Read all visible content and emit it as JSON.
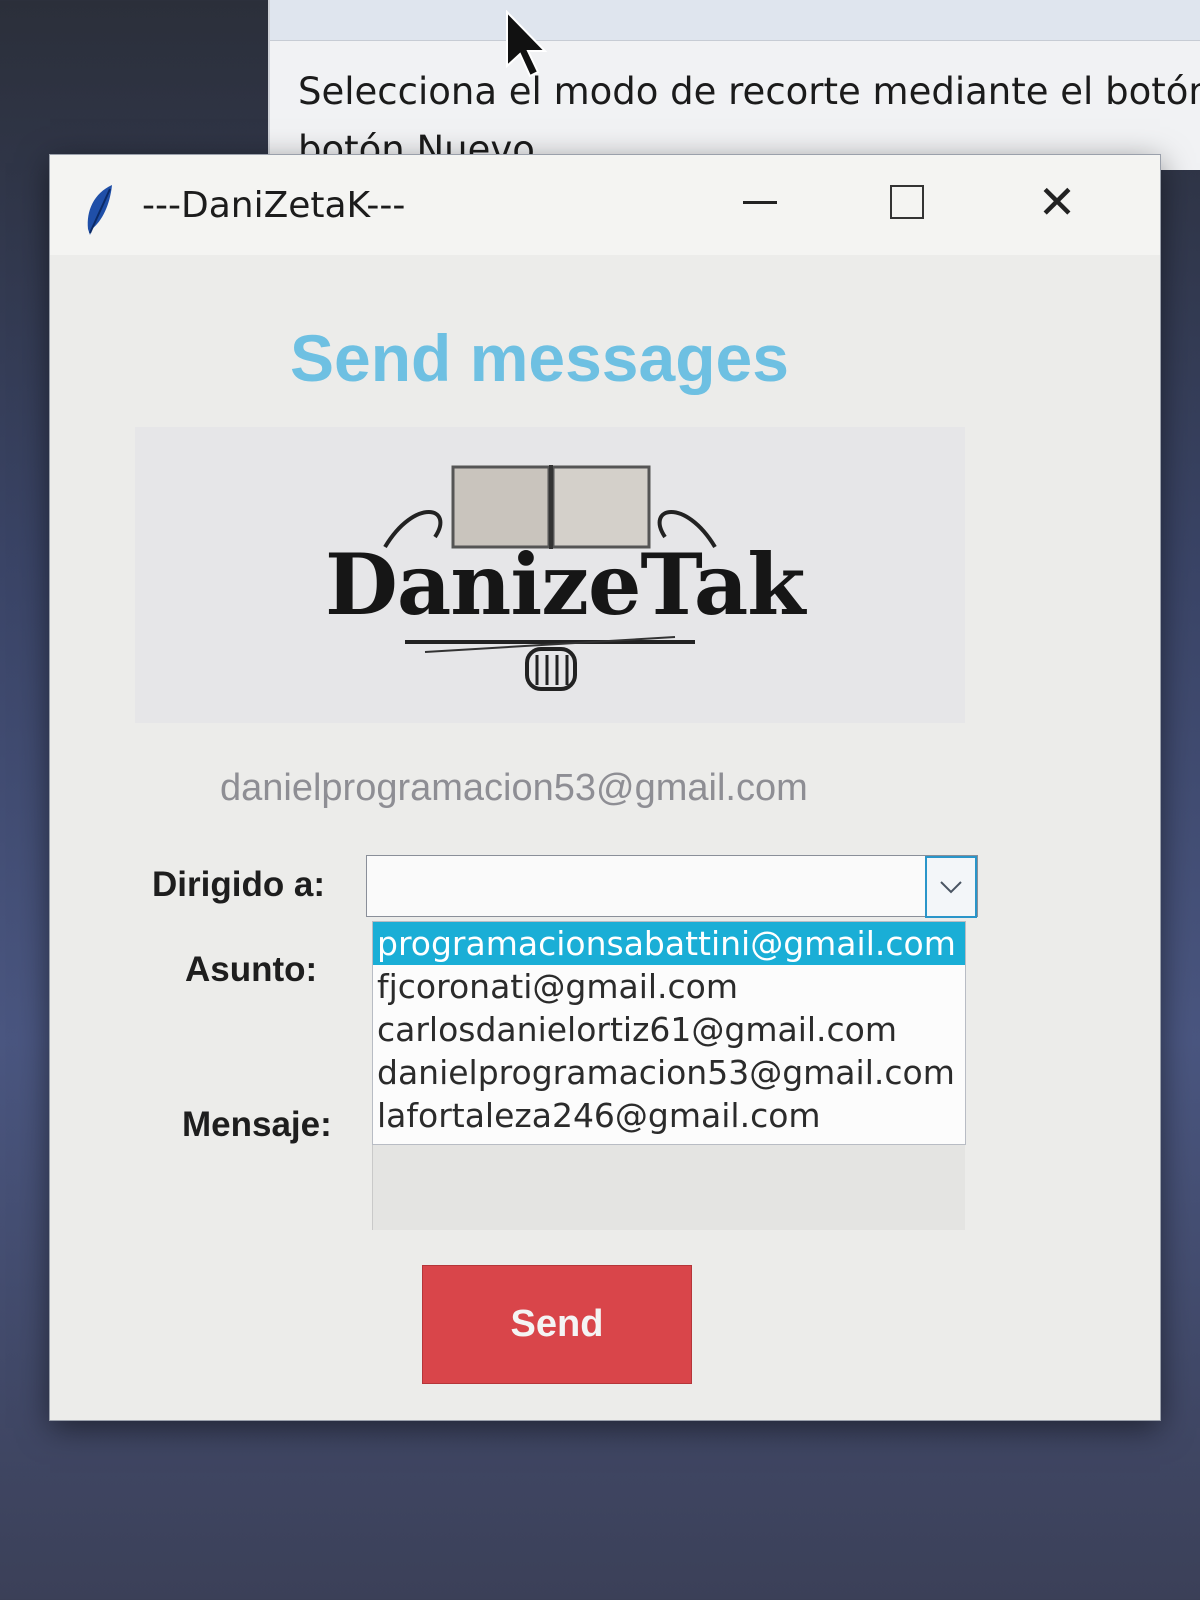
{
  "background_window": {
    "line1": "Selecciona el modo de recorte mediante el botón M",
    "line2": "botón Nuevo"
  },
  "window": {
    "title": "---DaniZetaK---",
    "icon": "feather-icon",
    "controls": {
      "minimize": "minimize-icon",
      "maximize": "maximize-icon",
      "close": "close-icon"
    }
  },
  "header": {
    "title": "Send messages",
    "color": "#6ec0e2"
  },
  "logo": {
    "text": "DanizeTak"
  },
  "sender_email": "danielprogramacion53@gmail.com",
  "form": {
    "to_label": "Dirigido a:",
    "to_value": "",
    "subject_label": "Asunto:",
    "message_label": "Mensaje:",
    "dropdown_options": [
      {
        "label": "programacionsabattini@gmail.com",
        "selected": true
      },
      {
        "label": "fjcoronati@gmail.com",
        "selected": false
      },
      {
        "label": "carlosdanielortiz61@gmail.com",
        "selected": false
      },
      {
        "label": "danielprogramacion53@gmail.com",
        "selected": false
      },
      {
        "label": "lafortaleza246@gmail.com",
        "selected": false
      }
    ],
    "highlight_color": "#1aaed6"
  },
  "send_button": {
    "label": "Send",
    "color": "#d9454a"
  }
}
